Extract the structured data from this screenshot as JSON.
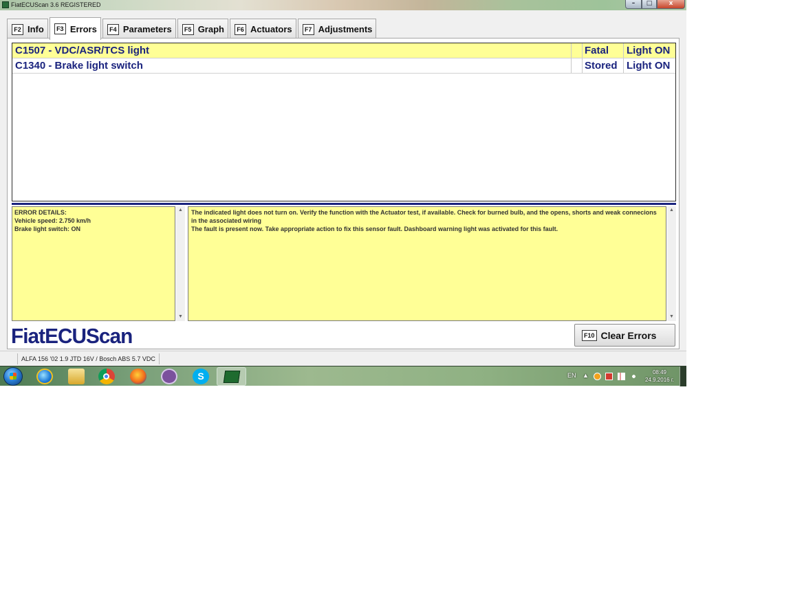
{
  "window": {
    "title": "FiatECUScan 3.6 REGISTERED",
    "controls": {
      "minimize": "–",
      "maximize": "□",
      "close": "x"
    }
  },
  "tabs": [
    {
      "key": "F2",
      "label": "Info",
      "active": false
    },
    {
      "key": "F3",
      "label": "Errors",
      "active": true
    },
    {
      "key": "F4",
      "label": "Parameters",
      "active": false
    },
    {
      "key": "F5",
      "label": "Graph",
      "active": false
    },
    {
      "key": "F6",
      "label": "Actuators",
      "active": false
    },
    {
      "key": "F7",
      "label": "Adjustments",
      "active": false
    }
  ],
  "errors": [
    {
      "code": "C1507 - VDC/ASR/TCS light",
      "status": "Fatal",
      "light": "Light ON",
      "selected": true
    },
    {
      "code": "C1340 - Brake light switch",
      "status": "Stored",
      "light": "Light ON",
      "selected": false
    }
  ],
  "details": {
    "heading": "ERROR DETAILS:",
    "lines": [
      "Vehicle speed: 2.750 km/h",
      "Brake light switch: ON"
    ]
  },
  "description": {
    "line1": "The indicated light does not turn on. Verify the function with the Actuator test, if available. Check for burned bulb, and the opens, shorts and weak connecions in the associated wiring",
    "line2": "The fault is present now. Take appropriate action to fix this sensor fault. Dashboard warning light was activated for this fault."
  },
  "logo": "FiatECUScan",
  "clear_button": {
    "key": "F10",
    "label": "Clear Errors"
  },
  "statusbar": {
    "vehicle": "ALFA 156 '02 1.9 JTD 16V / Bosch ABS 5.7 VDC"
  },
  "taskbar": {
    "apps": [
      "internet-explorer-icon",
      "file-explorer-icon",
      "chrome-icon",
      "firefox-icon",
      "viber-icon",
      "skype-icon",
      "fiatecuscan-icon"
    ],
    "language": "EN",
    "time": "08:49",
    "date": "24.9.2016 г."
  },
  "colors": {
    "highlight": "#ffff96",
    "accent": "#1a237e"
  }
}
